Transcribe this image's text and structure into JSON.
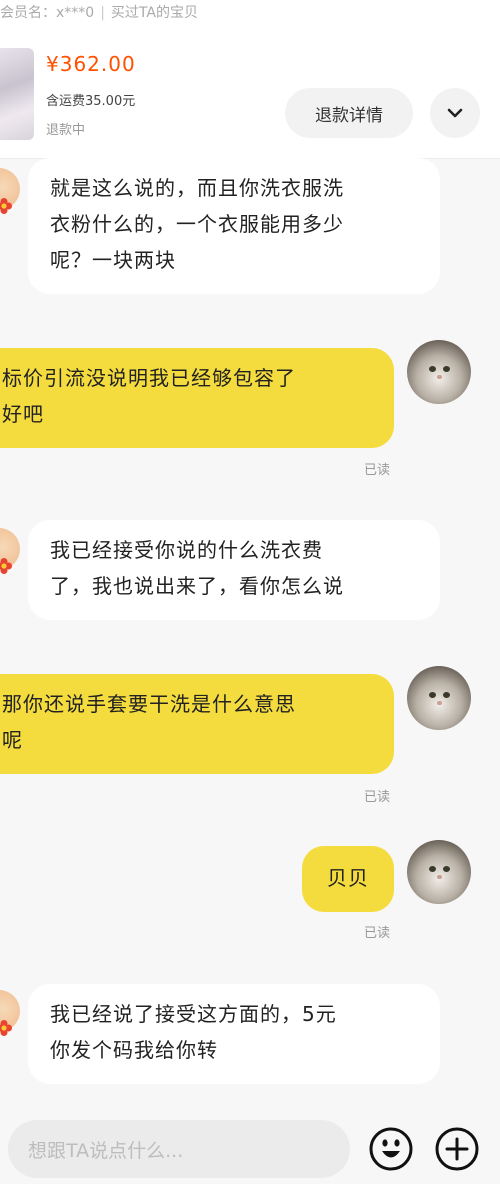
{
  "header": {
    "member_label": "会员名：",
    "member_name": "x***0",
    "bought_link": "买过TA的宝贝",
    "price": "¥362.00",
    "shipping": "含运费35.00元",
    "status": "退款中",
    "refund_button": "退款详情"
  },
  "messages": [
    {
      "side": "in",
      "lines": [
        "就是这么说的，而且你洗衣服洗",
        "衣粉什么的，一个衣服能用多少",
        "呢？一块两块"
      ]
    },
    {
      "side": "out",
      "lines": [
        "标价引流没说明我已经够包容了",
        "好吧"
      ],
      "read": "已读"
    },
    {
      "side": "in",
      "lines": [
        "我已经接受你说的什么洗衣费",
        "了，我也说出来了，看你怎么说"
      ]
    },
    {
      "side": "out",
      "lines": [
        "那你还说手套要干洗是什么意思",
        "呢"
      ],
      "read": "已读"
    },
    {
      "side": "out",
      "lines": [
        "贝贝"
      ],
      "read": "已读"
    },
    {
      "side": "in",
      "lines": [
        "我已经说了接受这方面的，5元",
        "你发个码我给你转"
      ]
    }
  ],
  "input": {
    "placeholder": "想跟TA说点什么..."
  },
  "icons": {
    "expand": "chevron-down-icon",
    "emoji": "emoji-icon",
    "add": "plus-icon"
  },
  "colors": {
    "price": "#ff5000",
    "outgoing_bubble": "#f4dc3e",
    "incoming_bubble": "#ffffff"
  }
}
